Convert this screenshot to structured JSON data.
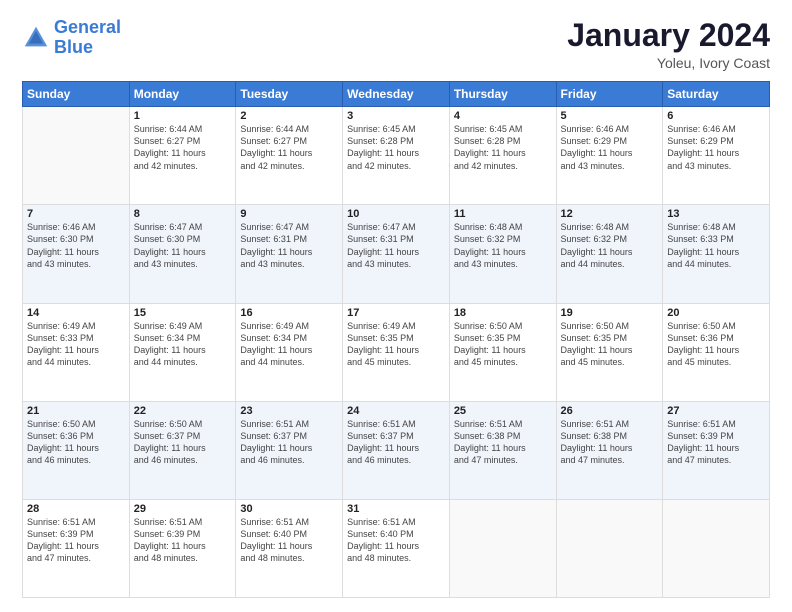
{
  "logo": {
    "line1": "General",
    "line2": "Blue"
  },
  "title": "January 2024",
  "subtitle": "Yoleu, Ivory Coast",
  "days_of_week": [
    "Sunday",
    "Monday",
    "Tuesday",
    "Wednesday",
    "Thursday",
    "Friday",
    "Saturday"
  ],
  "weeks": [
    [
      {
        "day": "",
        "info": ""
      },
      {
        "day": "1",
        "info": "Sunrise: 6:44 AM\nSunset: 6:27 PM\nDaylight: 11 hours\nand 42 minutes."
      },
      {
        "day": "2",
        "info": "Sunrise: 6:44 AM\nSunset: 6:27 PM\nDaylight: 11 hours\nand 42 minutes."
      },
      {
        "day": "3",
        "info": "Sunrise: 6:45 AM\nSunset: 6:28 PM\nDaylight: 11 hours\nand 42 minutes."
      },
      {
        "day": "4",
        "info": "Sunrise: 6:45 AM\nSunset: 6:28 PM\nDaylight: 11 hours\nand 42 minutes."
      },
      {
        "day": "5",
        "info": "Sunrise: 6:46 AM\nSunset: 6:29 PM\nDaylight: 11 hours\nand 43 minutes."
      },
      {
        "day": "6",
        "info": "Sunrise: 6:46 AM\nSunset: 6:29 PM\nDaylight: 11 hours\nand 43 minutes."
      }
    ],
    [
      {
        "day": "7",
        "info": "Sunrise: 6:46 AM\nSunset: 6:30 PM\nDaylight: 11 hours\nand 43 minutes."
      },
      {
        "day": "8",
        "info": "Sunrise: 6:47 AM\nSunset: 6:30 PM\nDaylight: 11 hours\nand 43 minutes."
      },
      {
        "day": "9",
        "info": "Sunrise: 6:47 AM\nSunset: 6:31 PM\nDaylight: 11 hours\nand 43 minutes."
      },
      {
        "day": "10",
        "info": "Sunrise: 6:47 AM\nSunset: 6:31 PM\nDaylight: 11 hours\nand 43 minutes."
      },
      {
        "day": "11",
        "info": "Sunrise: 6:48 AM\nSunset: 6:32 PM\nDaylight: 11 hours\nand 43 minutes."
      },
      {
        "day": "12",
        "info": "Sunrise: 6:48 AM\nSunset: 6:32 PM\nDaylight: 11 hours\nand 44 minutes."
      },
      {
        "day": "13",
        "info": "Sunrise: 6:48 AM\nSunset: 6:33 PM\nDaylight: 11 hours\nand 44 minutes."
      }
    ],
    [
      {
        "day": "14",
        "info": "Sunrise: 6:49 AM\nSunset: 6:33 PM\nDaylight: 11 hours\nand 44 minutes."
      },
      {
        "day": "15",
        "info": "Sunrise: 6:49 AM\nSunset: 6:34 PM\nDaylight: 11 hours\nand 44 minutes."
      },
      {
        "day": "16",
        "info": "Sunrise: 6:49 AM\nSunset: 6:34 PM\nDaylight: 11 hours\nand 44 minutes."
      },
      {
        "day": "17",
        "info": "Sunrise: 6:49 AM\nSunset: 6:35 PM\nDaylight: 11 hours\nand 45 minutes."
      },
      {
        "day": "18",
        "info": "Sunrise: 6:50 AM\nSunset: 6:35 PM\nDaylight: 11 hours\nand 45 minutes."
      },
      {
        "day": "19",
        "info": "Sunrise: 6:50 AM\nSunset: 6:35 PM\nDaylight: 11 hours\nand 45 minutes."
      },
      {
        "day": "20",
        "info": "Sunrise: 6:50 AM\nSunset: 6:36 PM\nDaylight: 11 hours\nand 45 minutes."
      }
    ],
    [
      {
        "day": "21",
        "info": "Sunrise: 6:50 AM\nSunset: 6:36 PM\nDaylight: 11 hours\nand 46 minutes."
      },
      {
        "day": "22",
        "info": "Sunrise: 6:50 AM\nSunset: 6:37 PM\nDaylight: 11 hours\nand 46 minutes."
      },
      {
        "day": "23",
        "info": "Sunrise: 6:51 AM\nSunset: 6:37 PM\nDaylight: 11 hours\nand 46 minutes."
      },
      {
        "day": "24",
        "info": "Sunrise: 6:51 AM\nSunset: 6:37 PM\nDaylight: 11 hours\nand 46 minutes."
      },
      {
        "day": "25",
        "info": "Sunrise: 6:51 AM\nSunset: 6:38 PM\nDaylight: 11 hours\nand 47 minutes."
      },
      {
        "day": "26",
        "info": "Sunrise: 6:51 AM\nSunset: 6:38 PM\nDaylight: 11 hours\nand 47 minutes."
      },
      {
        "day": "27",
        "info": "Sunrise: 6:51 AM\nSunset: 6:39 PM\nDaylight: 11 hours\nand 47 minutes."
      }
    ],
    [
      {
        "day": "28",
        "info": "Sunrise: 6:51 AM\nSunset: 6:39 PM\nDaylight: 11 hours\nand 47 minutes."
      },
      {
        "day": "29",
        "info": "Sunrise: 6:51 AM\nSunset: 6:39 PM\nDaylight: 11 hours\nand 48 minutes."
      },
      {
        "day": "30",
        "info": "Sunrise: 6:51 AM\nSunset: 6:40 PM\nDaylight: 11 hours\nand 48 minutes."
      },
      {
        "day": "31",
        "info": "Sunrise: 6:51 AM\nSunset: 6:40 PM\nDaylight: 11 hours\nand 48 minutes."
      },
      {
        "day": "",
        "info": ""
      },
      {
        "day": "",
        "info": ""
      },
      {
        "day": "",
        "info": ""
      }
    ]
  ]
}
